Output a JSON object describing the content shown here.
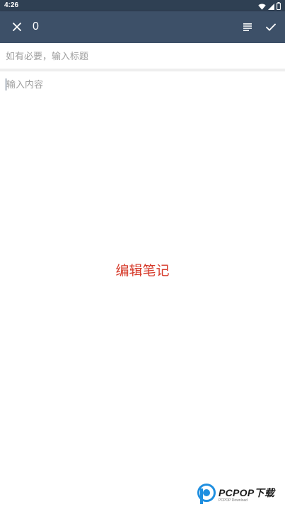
{
  "status_bar": {
    "time": "4:26",
    "icons": [
      "wifi-icon",
      "signal-icon",
      "battery-icon"
    ]
  },
  "toolbar": {
    "close_icon": "close-icon",
    "word_count": "0",
    "format_icon": "format-list-icon",
    "confirm_icon": "check-icon"
  },
  "editor": {
    "title_placeholder": "如有必要，输入标题",
    "content_placeholder": "输入内容"
  },
  "caption": "编辑笔记",
  "watermark": {
    "brand": "PCPOP下载",
    "tagline": "PCPOP Download"
  },
  "colors": {
    "status_bar": "#2f4053",
    "toolbar": "#3d5068",
    "caption": "#d63b2b",
    "watermark_blue": "#1f8fe0"
  }
}
